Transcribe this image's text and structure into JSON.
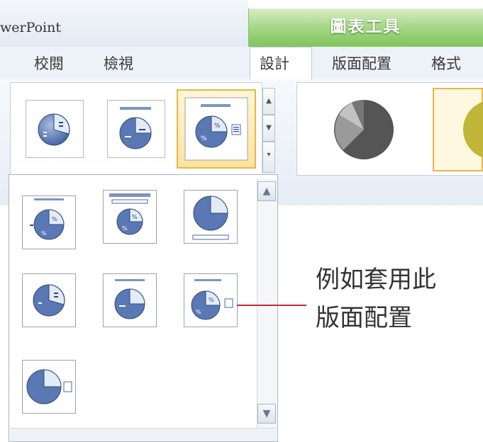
{
  "window": {
    "app_title": "werPoint"
  },
  "chart_tools": {
    "title": "圖表工具"
  },
  "tabs": {
    "review": "校閱",
    "view": "檢視",
    "design": "設計",
    "layout": "版面配置",
    "format": "格式"
  },
  "gallery": {
    "scroll_up": "▲",
    "scroll_down": "▼",
    "more": "▾",
    "top_items": [
      "layout-4",
      "layout-5",
      "layout-6"
    ],
    "selected_item": "layout-6"
  },
  "chart_styles": {
    "selected_index": 2
  },
  "dropdown": {
    "items": [
      "layout-1",
      "layout-2",
      "layout-3",
      "layout-4",
      "layout-5",
      "layout-6",
      "layout-7"
    ],
    "scroll_up": "▲",
    "scroll_down": "▼"
  },
  "callout": {
    "line1": "例如套用此",
    "line2": "版面配置"
  },
  "colors": {
    "chart_tools_green": "#7fc55a",
    "selection_gold": "#e8b64a",
    "pie_blue": "#4a69a8",
    "callout_red": "#c6283b"
  }
}
